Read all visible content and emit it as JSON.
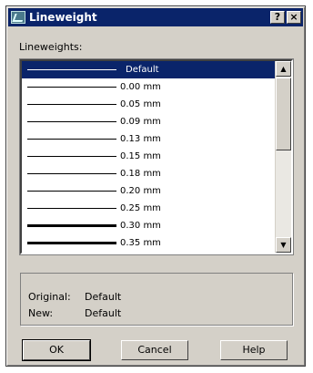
{
  "window": {
    "title": "Lineweight",
    "help_btn": "?",
    "close_btn": "×"
  },
  "list": {
    "label": "Lineweights:",
    "items": [
      {
        "label": "Default",
        "selected": true,
        "thickness": 1
      },
      {
        "label": "0.00 mm",
        "thickness": 1
      },
      {
        "label": "0.05 mm",
        "thickness": 1
      },
      {
        "label": "0.09 mm",
        "thickness": 1
      },
      {
        "label": "0.13 mm",
        "thickness": 1
      },
      {
        "label": "0.15 mm",
        "thickness": 1
      },
      {
        "label": "0.18 mm",
        "thickness": 1
      },
      {
        "label": "0.20 mm",
        "thickness": 1
      },
      {
        "label": "0.25 mm",
        "thickness": 1
      },
      {
        "label": "0.30 mm",
        "thickness": 3
      },
      {
        "label": "0.35 mm",
        "thickness": 3
      }
    ]
  },
  "info": {
    "original_label": "Original:",
    "original_value": "Default",
    "new_label": "New:",
    "new_value": "Default"
  },
  "buttons": {
    "ok": "OK",
    "cancel": "Cancel",
    "help": "Help"
  },
  "colors": {
    "title_bar": "#0a246a",
    "dialog_bg": "#d4d0c8",
    "selection": "#0a246a"
  }
}
